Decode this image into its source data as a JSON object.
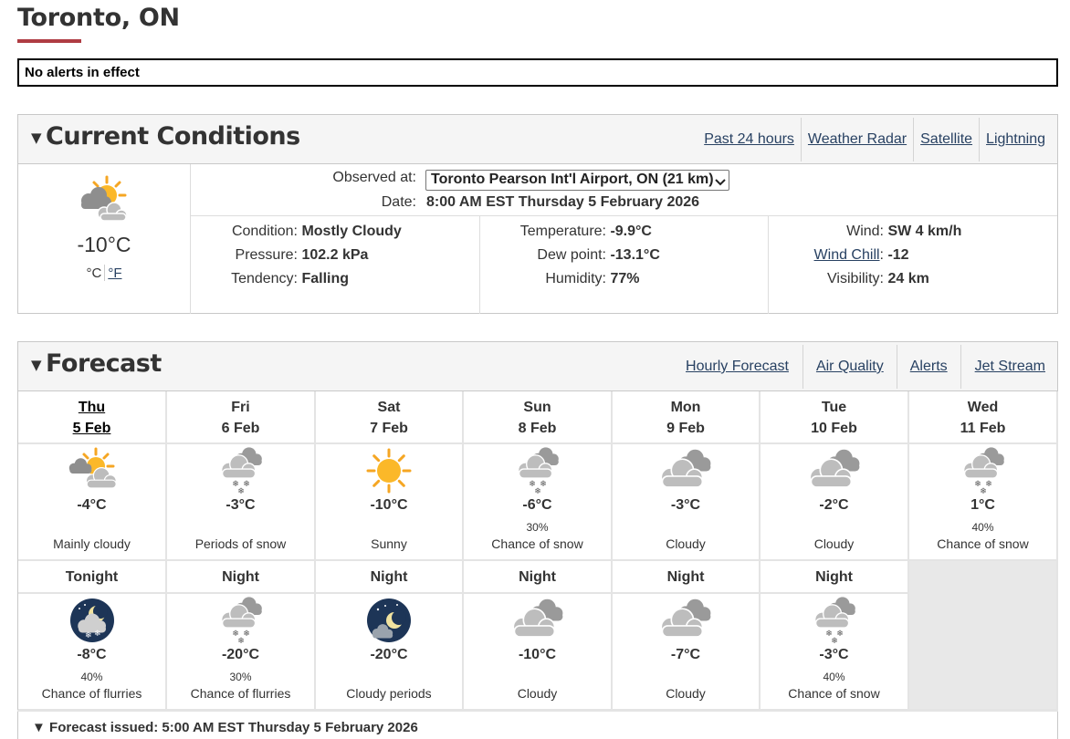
{
  "page": {
    "title": "Toronto, ON",
    "alert_text": "No alerts in effect",
    "accent": "#af3c43"
  },
  "current": {
    "heading": "Current Conditions",
    "links": [
      "Past 24 hours",
      "Weather Radar",
      "Satellite",
      "Lightning"
    ],
    "icon": "mostly-cloudy-sun-icon",
    "temp": "-10°C",
    "unit_c": "°C",
    "unit_f": "°F",
    "observed_label": "Observed at:",
    "station": "Toronto Pearson Int'l Airport, ON (21 km)",
    "date_label": "Date:",
    "date": "8:00 AM EST Thursday 5 February 2026",
    "condition_label": "Condition:",
    "condition": "Mostly Cloudy",
    "pressure_label": "Pressure:",
    "pressure": "102.2 kPa",
    "tendency_label": "Tendency:",
    "tendency": "Falling",
    "temperature_label": "Temperature:",
    "temperature": "-9.9°C",
    "dewpoint_label": "Dew point:",
    "dewpoint": "-13.1°C",
    "humidity_label": "Humidity:",
    "humidity": "77%",
    "wind_label": "Wind:",
    "wind": "SW 4 km/h",
    "windchill_label": "Wind Chill",
    "windchill": "-12",
    "visibility_label": "Visibility:",
    "visibility": "24 km"
  },
  "forecast": {
    "heading": "Forecast",
    "links": [
      "Hourly Forecast",
      "Air Quality",
      "Alerts",
      "Jet Stream"
    ],
    "days": [
      {
        "name": "Thu",
        "date": "5 Feb",
        "icon": "mostly-cloudy-sun-icon",
        "temp": "-4°C",
        "pop": "",
        "summary": "Mainly cloudy"
      },
      {
        "name": "Fri",
        "date": "6 Feb",
        "icon": "snow-cloud-icon",
        "temp": "-3°C",
        "pop": "",
        "summary": "Periods of snow"
      },
      {
        "name": "Sat",
        "date": "7 Feb",
        "icon": "sun-icon",
        "temp": "-10°C",
        "pop": "",
        "summary": "Sunny"
      },
      {
        "name": "Sun",
        "date": "8 Feb",
        "icon": "snow-cloud-icon",
        "temp": "-6°C",
        "pop": "30%",
        "summary": "Chance of snow"
      },
      {
        "name": "Mon",
        "date": "9 Feb",
        "icon": "cloud-icon",
        "temp": "-3°C",
        "pop": "",
        "summary": "Cloudy"
      },
      {
        "name": "Tue",
        "date": "10 Feb",
        "icon": "cloud-icon",
        "temp": "-2°C",
        "pop": "",
        "summary": "Cloudy"
      },
      {
        "name": "Wed",
        "date": "11 Feb",
        "icon": "snow-cloud-icon",
        "temp": "1°C",
        "pop": "40%",
        "summary": "Chance of snow"
      }
    ],
    "nights": [
      {
        "name": "Tonight",
        "icon": "moon-flurries-icon",
        "temp": "-8°C",
        "pop": "40%",
        "summary": "Chance of flurries"
      },
      {
        "name": "Night",
        "icon": "snow-cloud-icon",
        "temp": "-20°C",
        "pop": "30%",
        "summary": "Chance of flurries"
      },
      {
        "name": "Night",
        "icon": "moon-cloud-icon",
        "temp": "-20°C",
        "pop": "",
        "summary": "Cloudy periods"
      },
      {
        "name": "Night",
        "icon": "cloud-icon",
        "temp": "-10°C",
        "pop": "",
        "summary": "Cloudy"
      },
      {
        "name": "Night",
        "icon": "cloud-icon",
        "temp": "-7°C",
        "pop": "",
        "summary": "Cloudy"
      },
      {
        "name": "Night",
        "icon": "snow-cloud-icon",
        "temp": "-3°C",
        "pop": "40%",
        "summary": "Chance of snow"
      }
    ],
    "issued": "Forecast issued: 5:00 AM EST Thursday 5 February 2026"
  }
}
